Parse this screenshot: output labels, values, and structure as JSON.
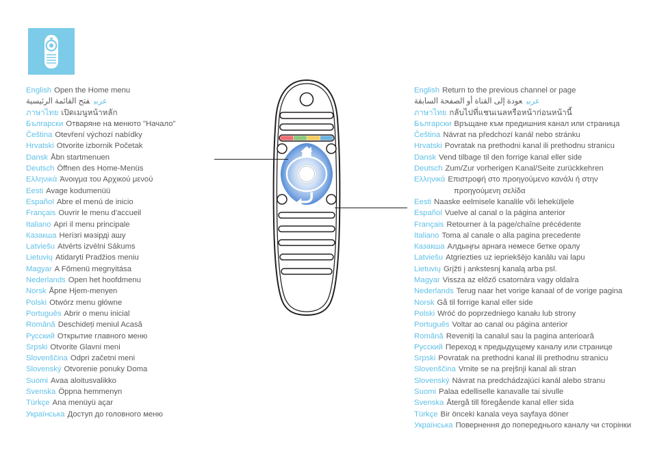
{
  "badge": {
    "icon": "remote-control-icon",
    "background_color": "#7ccbe8"
  },
  "colors": {
    "label_blue": "#5fc0e8",
    "body_gray": "#58585a",
    "badge_blue": "#7ccbe8",
    "nav_pad_blue": "#2a6cc4",
    "button_red": "#ef6f73",
    "button_green": "#8cc97c",
    "button_yellow": "#f4cc5e",
    "button_blue": "#6fb2e0"
  },
  "remote": {
    "icon_home": "home-icon",
    "icon_back": "back-arrow-icon",
    "color_buttons": [
      "button_red",
      "button_green",
      "button_yellow",
      "button_blue"
    ]
  },
  "callouts": [
    {
      "name": "home-button-callout",
      "target": "home-button"
    },
    {
      "name": "back-button-callout",
      "target": "back-button"
    }
  ],
  "columns": {
    "left": {
      "name": "home-menu-translations",
      "rows": [
        {
          "label": "English",
          "text": "Open the Home menu"
        },
        {
          "label": "عربي",
          "text": "فتح القائمة الرئيسية",
          "dir": "rtl"
        },
        {
          "label": "ภาษาไทย",
          "text": "เปิดเมนูหน้าหลัก",
          "script": "thai"
        },
        {
          "label": "Български",
          "text": "Отваряне на менюто \"Начало\""
        },
        {
          "label": "Čeština",
          "text": "Otevření výchozí nabídky"
        },
        {
          "label": "Hrvatski",
          "text": "Otvorite izbornik Početak"
        },
        {
          "label": "Dansk",
          "text": "Åbn startmenuen"
        },
        {
          "label": "Deutsch",
          "text": "Öffnen des Home-Menüs"
        },
        {
          "label": "Ελληνικά",
          "text": "Άνοιγμα του Αρχικού μενού"
        },
        {
          "label": "Eesti",
          "text": "Avage kodumenüü"
        },
        {
          "label": "Español",
          "text": "Abre el menú de inicio"
        },
        {
          "label": "Français",
          "text": "Ouvrir le menu d'accueil"
        },
        {
          "label": "Italiano",
          "text": "Apri il menu principale"
        },
        {
          "label": "Казакша",
          "text": "Негізгі мәзірді ашу"
        },
        {
          "label": "Latviešu",
          "text": "Atvērts izvēlni Sākums"
        },
        {
          "label": "Lietuvių",
          "text": "Atidaryti Pradžios meniu"
        },
        {
          "label": "Magyar",
          "text": "A Főmenü megnyitása"
        },
        {
          "label": "Nederlands",
          "text": "Open het hoofdmenu"
        },
        {
          "label": "Norsk",
          "text": "Åpne Hjem-menyen"
        },
        {
          "label": "Polski",
          "text": "Otwórz menu główne"
        },
        {
          "label": "Português",
          "text": "Abrir o menu inicial"
        },
        {
          "label": "Română",
          "text": "Deschideți meniul Acasă"
        },
        {
          "label": "Русский",
          "text": "Открытие главного меню"
        },
        {
          "label": "Srpski",
          "text": "Otvorite Glavni meni"
        },
        {
          "label": "Slovenščina",
          "text": "Odpri začetni meni"
        },
        {
          "label": "Slovenský",
          "text": "Otvorenie ponuky Doma"
        },
        {
          "label": "Suomi",
          "text": "Avaa aloitusvalikko"
        },
        {
          "label": "Svenska",
          "text": "Öppna hemmenyn"
        },
        {
          "label": "Türkçe",
          "text": "Ana menüyü açar"
        },
        {
          "label": "Українська",
          "text": "Доступ до головного меню"
        }
      ]
    },
    "right": {
      "name": "previous-channel-translations",
      "rows": [
        {
          "label": "English",
          "text": "Return to the previous channel or page"
        },
        {
          "label": "عربي",
          "text": "عودة إلى القناة أو الصفحة السابقة",
          "dir": "rtl"
        },
        {
          "label": "ภาษาไทย",
          "text": "กลับไปที่แชนเนลหรือหน้าก่อนหน้านี้",
          "script": "thai"
        },
        {
          "label": "Български",
          "text": "Връщане към предишния канал или страница"
        },
        {
          "label": "Čeština",
          "text": "Návrat na předchozí kanál nebo stránku"
        },
        {
          "label": "Hrvatski",
          "text": "Povratak na prethodni kanal ili prethodnu stranicu"
        },
        {
          "label": "Dansk",
          "text": "Vend tilbage til den forrige kanal eller side"
        },
        {
          "label": "Deutsch",
          "text": "Zum/Zur vorherigen Kanal/Seite zurückkehren"
        },
        {
          "label": "Ελληνικά",
          "text": "Επιστροφή στο προηγούμενο κανάλι ή στην"
        },
        {
          "label": "",
          "text": "προηγούμενη σελίδα",
          "cont": true
        },
        {
          "label": "Eesti",
          "text": "Naaske eelmisele kanalile või leheküljele"
        },
        {
          "label": "Español",
          "text": "Vuelve al canal o la página anterior"
        },
        {
          "label": "Français",
          "text": "Retourner à la page/chaîne précédente"
        },
        {
          "label": "Italiano",
          "text": "Toma al canale o alla pagina precedente"
        },
        {
          "label": "Казакша",
          "text": "Алдыңғы арнаға немесе бетке оралу"
        },
        {
          "label": "Latviešu",
          "text": "Atgriezties uz iepriekšējo kanālu vai lapu"
        },
        {
          "label": "Lietuvių",
          "text": "Grįžti į ankstesnj kanalą arba psl."
        },
        {
          "label": "Magyar",
          "text": "Vissza az előző csatornára vagy oldalra"
        },
        {
          "label": "Nederlands",
          "text": "Terug naar het vorige kanaal of de vorige pagina"
        },
        {
          "label": "Norsk",
          "text": "Gå til forrige kanal eller side"
        },
        {
          "label": "Polski",
          "text": "Wróć do poprzedniego kanału lub strony"
        },
        {
          "label": "Português",
          "text": "Voltar ao canal ou página anterior"
        },
        {
          "label": "Română",
          "text": "Reveniți la canalul sau la pagina anterioară"
        },
        {
          "label": "Русский",
          "text": "Переход к предыдущему каналу или странице"
        },
        {
          "label": "Srpski",
          "text": "Povratak na prethodni kanal ili prethodnu stranicu"
        },
        {
          "label": "Slovenščina",
          "text": "Vrnite se na prejšnji kanal ali stran"
        },
        {
          "label": "Slovenský",
          "text": "Návrat na predchádzajúci kanál alebo stranu"
        },
        {
          "label": "Suomi",
          "text": "Palaa edelliselle kanavalle tai sivulle"
        },
        {
          "label": "Svenska",
          "text": "Återgå till föregående kanal eller sida"
        },
        {
          "label": "Türkçe",
          "text": "Bir önceki kanala veya sayfaya döner"
        },
        {
          "label": "Українська",
          "text": "Повернення до попереднього каналу чи сторінки"
        }
      ]
    }
  }
}
